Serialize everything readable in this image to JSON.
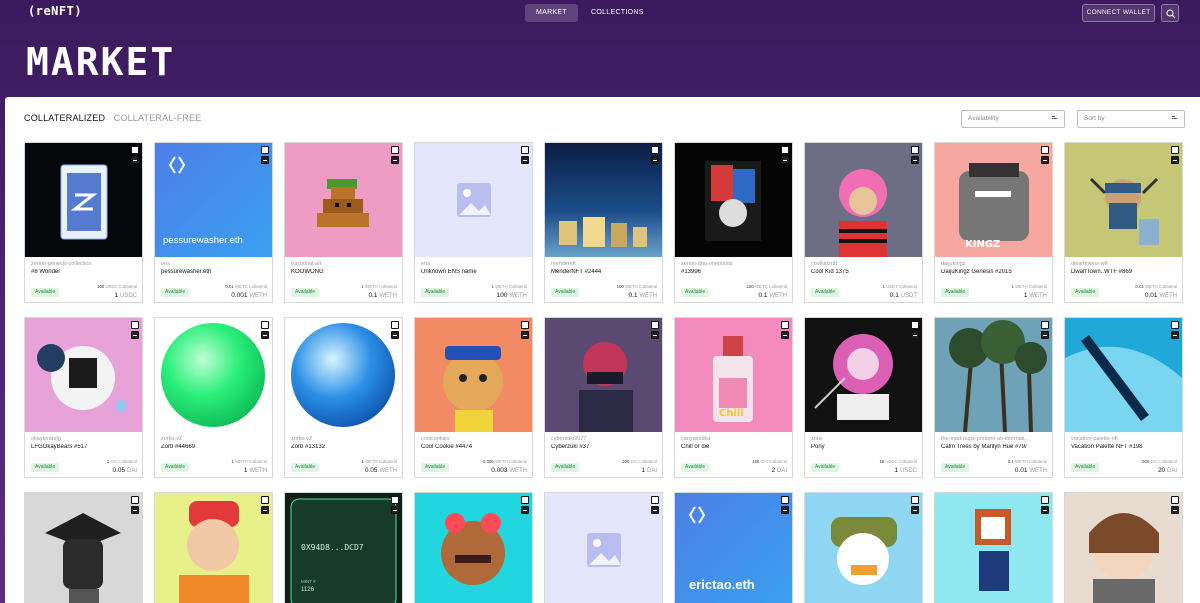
{
  "nav": {
    "logo": "(reNFT)",
    "tabs": [
      {
        "label": "MARKET",
        "active": true
      },
      {
        "label": "COLLECTIONS",
        "active": false
      }
    ],
    "connect_wallet": "CONNECT WALLET",
    "search_icon": "search-icon"
  },
  "hero": {
    "title": "MARKET"
  },
  "filters": {
    "tabs": [
      {
        "label": "COLLATERALIZED",
        "active": true
      },
      {
        "label": "COLLATERAL-FREE",
        "active": false
      }
    ],
    "availability_placeholder": "Availability",
    "sortby_placeholder": "Sort by"
  },
  "colors": {
    "header_gradient_top": "#3a1a5c",
    "header_gradient_bottom": "#5a2d84",
    "available_badge_bg": "#dff5e3",
    "available_badge_text": "#1f8a3b"
  },
  "cards": [
    {
      "collection": "zerion-genesis-collection",
      "name": "#8 Wonder",
      "badge": "Available",
      "collateral_amount": "100",
      "collateral_token": "USDC",
      "price": "1",
      "price_token": "USDC"
    },
    {
      "collection": "ens",
      "name": "pessurewasher.eth",
      "badge": "Available",
      "collateral_amount": "0.01",
      "collateral_token": "WETH",
      "price": "0.001",
      "price_token": "WETH",
      "media_text": "pessurewasher.eth"
    },
    {
      "collection": "fractional-art",
      "name": "KOOWONG",
      "badge": "Available",
      "collateral_amount": "1",
      "collateral_token": "WETH",
      "price": "0.1",
      "price_token": "WETH"
    },
    {
      "collection": "ens",
      "name": "Unknown ENS name",
      "badge": "Available",
      "collateral_amount": "1",
      "collateral_token": "WETH",
      "price": "100",
      "price_token": "WETH"
    },
    {
      "collection": "mendernft",
      "name": "MenderNFT #2444",
      "badge": "Available",
      "collateral_amount": "100",
      "collateral_token": "WETH",
      "price": "0.1",
      "price_token": "WETH"
    },
    {
      "collection": "zerion-dna-onepoints",
      "name": "#13996",
      "badge": "Available",
      "collateral_amount": "100",
      "collateral_token": "WETH",
      "price": "0.1",
      "price_token": "WETH"
    },
    {
      "collection": "coolkidznft",
      "name": "Cool Kid 1375",
      "badge": "Available",
      "collateral_amount": "1",
      "collateral_token": "USDT",
      "price": "0.1",
      "price_token": "USDT"
    },
    {
      "collection": "daijukingz",
      "name": "DaijuKingz Genesis #2015",
      "badge": "Available",
      "collateral_amount": "1",
      "collateral_token": "WETH",
      "price": "1",
      "price_token": "WETH"
    },
    {
      "collection": "dwarftowns-wtf",
      "name": "DwarfTown..WTF #869",
      "badge": "Available",
      "collateral_amount": "0.01",
      "collateral_token": "WETH",
      "price": "0.01",
      "price_token": "WETH"
    },
    {
      "collection": "okaybearsfg",
      "name": "LFGOkayBears #517",
      "badge": "Available",
      "collateral_amount": "1",
      "collateral_token": "DAI",
      "price": "0.05",
      "price_token": "DAI"
    },
    {
      "collection": "zorbs-v2",
      "name": "Zorb #44669",
      "badge": "Available",
      "collateral_amount": "1",
      "collateral_token": "WETH",
      "price": "1",
      "price_token": "WETH"
    },
    {
      "collection": "zorbs-v2",
      "name": "Zorb #13132",
      "badge": "Available",
      "collateral_amount": "1",
      "collateral_token": "WETH",
      "price": "0.05",
      "price_token": "WETH"
    },
    {
      "collection": "coolcookies",
      "name": "Cool Cookie #4474",
      "badge": "Available",
      "collateral_amount": "0.005",
      "collateral_token": "WETH",
      "price": "0.003",
      "price_token": "WETH"
    },
    {
      "collection": "cyberzuki2077",
      "name": "Cyberzuki #37",
      "badge": "Available",
      "collateral_amount": "100",
      "collateral_token": "DAI",
      "price": "1",
      "price_token": "DAI"
    },
    {
      "collection": "canyavodka",
      "name": "Chill or die",
      "badge": "Available",
      "collateral_amount": "150",
      "collateral_token": "DAI",
      "price": "2",
      "price_token": "DAI"
    },
    {
      "collection": "zora",
      "name": "Pony",
      "badge": "Available",
      "collateral_amount": "15",
      "collateral_token": "USDC",
      "price": "1",
      "price_token": "USDC"
    },
    {
      "collection": "the-mad-pups-present-an-internati...",
      "name": "Calm Trees by Marilyn Hue #79/",
      "badge": "Available",
      "collateral_amount": "0.1",
      "collateral_token": "WETH",
      "price": "0.01",
      "price_token": "WETH"
    },
    {
      "collection": "vacation-palette-nft",
      "name": "Vacation Palette NFT #198",
      "badge": "Available",
      "collateral_amount": "500",
      "collateral_token": "DAI",
      "price": "20",
      "price_token": "DAI"
    }
  ],
  "row3": [
    {
      "media_text": ""
    },
    {
      "media_text": ""
    },
    {
      "media_text": "0X94D8...DCD7",
      "sub_a": "MINT #",
      "sub_b": "1126"
    },
    {
      "media_text": ""
    },
    {
      "media_text": ""
    },
    {
      "media_text": "erictao.eth"
    },
    {
      "media_text": ""
    },
    {
      "media_text": ""
    },
    {
      "media_text": ""
    }
  ]
}
